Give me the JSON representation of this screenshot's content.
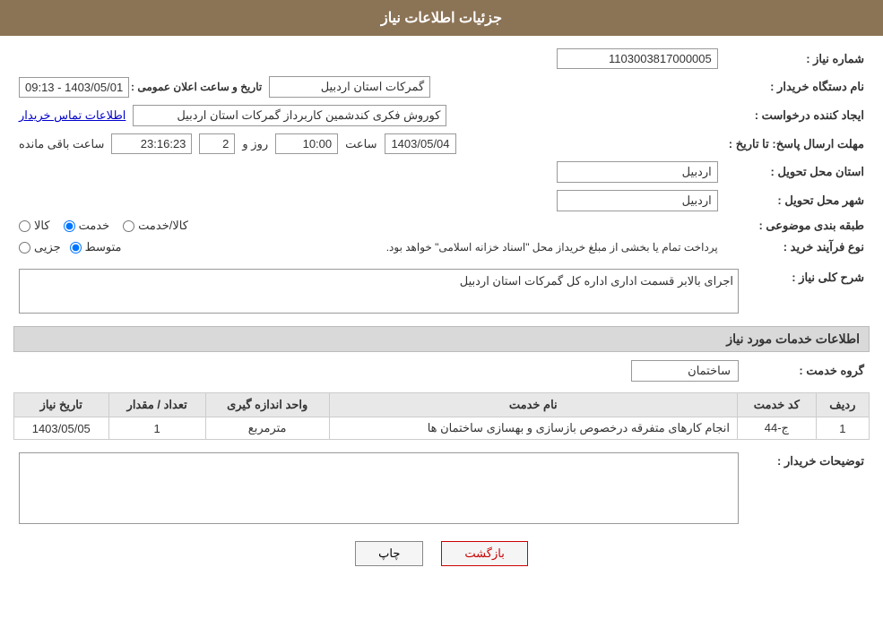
{
  "header": {
    "title": "جزئیات اطلاعات نیاز"
  },
  "fields": {
    "need_number_label": "شماره نیاز :",
    "need_number_value": "1103003817000005",
    "buyer_name_label": "نام دستگاه خریدار :",
    "buyer_name_value": "گمرکات استان اردبیل",
    "creator_label": "ایجاد کننده درخواست :",
    "creator_value": "کوروش فکری کندشمین کاربرداز گمرکات استان اردبیل",
    "contact_link": "اطلاعات تماس خریدار",
    "deadline_label": "مهلت ارسال پاسخ: تا تاریخ :",
    "deadline_date": "1403/05/04",
    "deadline_time_label": "ساعت",
    "deadline_time_value": "10:00",
    "deadline_days_label": "روز و",
    "deadline_days_value": "2",
    "deadline_remaining_label": "ساعت باقی مانده",
    "deadline_remaining_value": "23:16:23",
    "announce_label": "تاریخ و ساعت اعلان عمومی :",
    "announce_value": "1403/05/01 - 09:13",
    "province_label": "استان محل تحویل :",
    "province_value": "اردبیل",
    "city_label": "شهر محل تحویل :",
    "city_value": "اردبیل",
    "category_label": "طبقه بندی موضوعی :",
    "category_options": [
      {
        "id": "kala",
        "label": "کالا"
      },
      {
        "id": "khadamat",
        "label": "خدمت"
      },
      {
        "id": "kala_khadamat",
        "label": "کالا/خدمت"
      }
    ],
    "category_selected": "khadamat",
    "process_label": "نوع فرآیند خرید :",
    "process_options": [
      {
        "id": "jozi",
        "label": "جزیی"
      },
      {
        "id": "motavasset",
        "label": "متوسط"
      }
    ],
    "process_selected": "motavasset",
    "process_note": "پرداخت تمام یا بخشی از مبلغ خریداز محل \"اسناد خزانه اسلامی\" خواهد بود.",
    "general_desc_label": "شرح کلی نیاز :",
    "general_desc_value": "اجرای بالابر قسمت اداری اداره کل گمرکات استان اردبیل",
    "services_section_title": "اطلاعات خدمات مورد نیاز",
    "service_group_label": "گروه خدمت :",
    "service_group_value": "ساختمان",
    "table": {
      "headers": [
        "ردیف",
        "کد خدمت",
        "نام خدمت",
        "واحد اندازه گیری",
        "تعداد / مقدار",
        "تاریخ نیاز"
      ],
      "rows": [
        {
          "row": "1",
          "service_code": "ج-44",
          "service_name": "انجام کارهای متفرقه درخصوص بازسازی و بهسازی ساختمان ها",
          "unit": "مترمربع",
          "quantity": "1",
          "date": "1403/05/05"
        }
      ]
    },
    "buyer_notes_label": "توضیحات خریدار :",
    "buyer_notes_value": ""
  },
  "buttons": {
    "print_label": "چاپ",
    "back_label": "بازگشت"
  }
}
